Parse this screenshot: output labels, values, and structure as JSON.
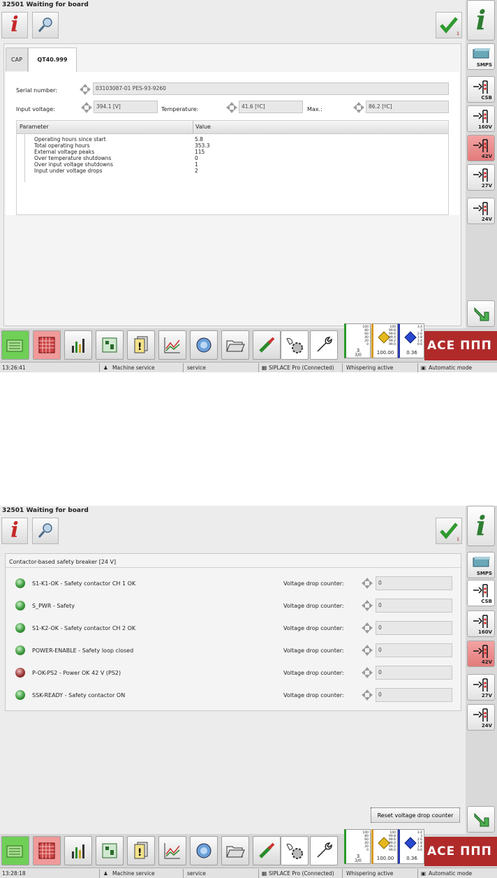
{
  "screens": [
    {
      "title": "32501 Waiting for board",
      "clock": "13:26:41",
      "tabs": [
        "CAP",
        "QT40.999"
      ],
      "serial_label": "Serial number:",
      "serial_value": "03103087-01 PES-93-9260",
      "input_voltage_label": "Input voltage:",
      "input_voltage_value": "394.1 [V]",
      "temperature_label": "Temperature:",
      "temperature_value": "41.6 [ºC]",
      "max_label": "Max.:",
      "max_value": "86.2 [ºC]",
      "grid_headers": [
        "Parameter",
        "Value"
      ],
      "grid_rows": [
        {
          "p": "Operating hours since start",
          "v": "5.8"
        },
        {
          "p": "Total operating hours",
          "v": "353.3"
        },
        {
          "p": "External voltage peaks",
          "v": "115"
        },
        {
          "p": "Over temperature shutdowns",
          "v": "0"
        },
        {
          "p": "Over input voltage shutdowns",
          "v": "1"
        },
        {
          "p": "Input under voltage drops",
          "v": "2"
        }
      ]
    },
    {
      "title": "32501 Waiting for board",
      "clock": "13:28:18",
      "panel_title": "Contactor-based safety breaker [24 V]",
      "counter_label": "Voltage drop counter:",
      "signals": [
        {
          "name": "S1-K1-OK  -  Safety contactor CH 1 OK",
          "state": "green",
          "counter": "0"
        },
        {
          "name": "S_PWR  -  Safety",
          "state": "green",
          "counter": "0"
        },
        {
          "name": "S1-K2-OK  -  Safety contactor CH 2 OK",
          "state": "green",
          "counter": "0"
        },
        {
          "name": "POWER-ENABLE  -  Safety loop closed",
          "state": "green",
          "counter": "0"
        },
        {
          "name": "P-OK-PS2  -  Power OK 42 V (PS2)",
          "state": "red",
          "counter": "0"
        },
        {
          "name": "SSK-READY  -  Safety contactor ON",
          "state": "green",
          "counter": "0"
        }
      ],
      "reset_button": "Reset voltage drop counter"
    }
  ],
  "side_buttons": [
    "SMPS",
    "CSB",
    "160V",
    "42V",
    "27V",
    "24V"
  ],
  "confirm_badge": "1",
  "status": {
    "user_role": "Machine service",
    "user": "service",
    "connection": "SIPLACE Pro (Connected)",
    "whisper": "Whispering active",
    "mode": "Automatic mode"
  },
  "brand": "ACE ППП",
  "gauges": {
    "g1_text": "100\n80\n60\n40\n20\n0",
    "g1_value": "3",
    "g1_sub": "3/0",
    "g2_text": "100\n99.8\n99.6\n99.4\n99.2\n99.0",
    "g2_value": "100.00",
    "g3_text": "3.4\n3\n2.6\n1.8\n1.4\n0.6",
    "g3_value": "0.36"
  },
  "colors": {
    "accent_green": "#6fcf57",
    "alert_red": "#f09a9a",
    "brand_red": "#b02a2a",
    "led_green": "#3c9a3c",
    "led_red": "#9a3434"
  }
}
